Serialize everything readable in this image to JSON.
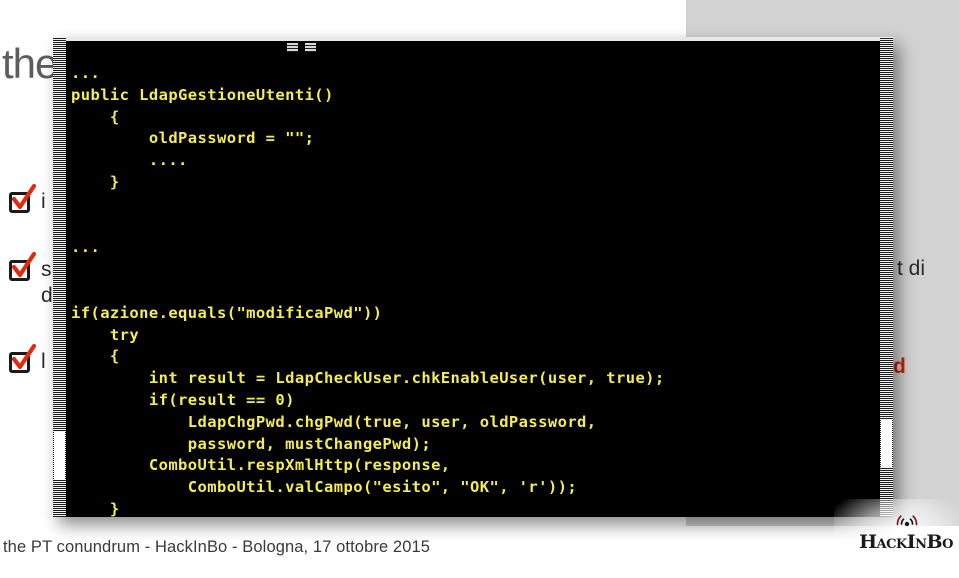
{
  "slide": {
    "big_word": "the",
    "background_color": "#ffffff",
    "panel_color": "#d2d2d2"
  },
  "bullets": [
    {
      "icon": "checked-checkbox-icon",
      "text": "i",
      "sub": ""
    },
    {
      "icon": "checked-checkbox-icon",
      "text": "s",
      "sub": "d"
    },
    {
      "icon": "checked-checkbox-icon",
      "text": "l",
      "sub": ""
    }
  ],
  "fragments": [
    {
      "text": "t di",
      "color": "#2b2b2b"
    },
    {
      "text": "d",
      "color": "#cc2200"
    }
  ],
  "code_window": {
    "title_glyphs": [
      "window-menu-glyph",
      "window-menu-glyph"
    ],
    "background_color": "#000000",
    "text_color": "#f3ec52",
    "code": "...\npublic LdapGestioneUtenti()\n    {\n        oldPassword = \"\";\n        ....\n    }\n\n\n...\n\n\nif(azione.equals(\"modificaPwd\"))\n    try\n    {\n        int result = LdapCheckUser.chkEnableUser(user, true);\n        if(result == 0)\n            LdapChgPwd.chgPwd(true, user, oldPassword,\n            password, mustChangePwd);\n        ComboUtil.respXmlHttp(response,\n            ComboUtil.valCampo(\"esito\", \"OK\", 'r'));\n    }\n..."
  },
  "footer": {
    "text": "the PT conundrum - HackInBo - Bologna, 17 ottobre 2015"
  },
  "logo": {
    "icon": "wifi-signal-icon",
    "name_part1": "H",
    "name_part2": "ACK",
    "name_part3": "I",
    "name_part4": "N",
    "name_part5": "B",
    "name_part6": "O",
    "full_name": "HackInBo"
  }
}
